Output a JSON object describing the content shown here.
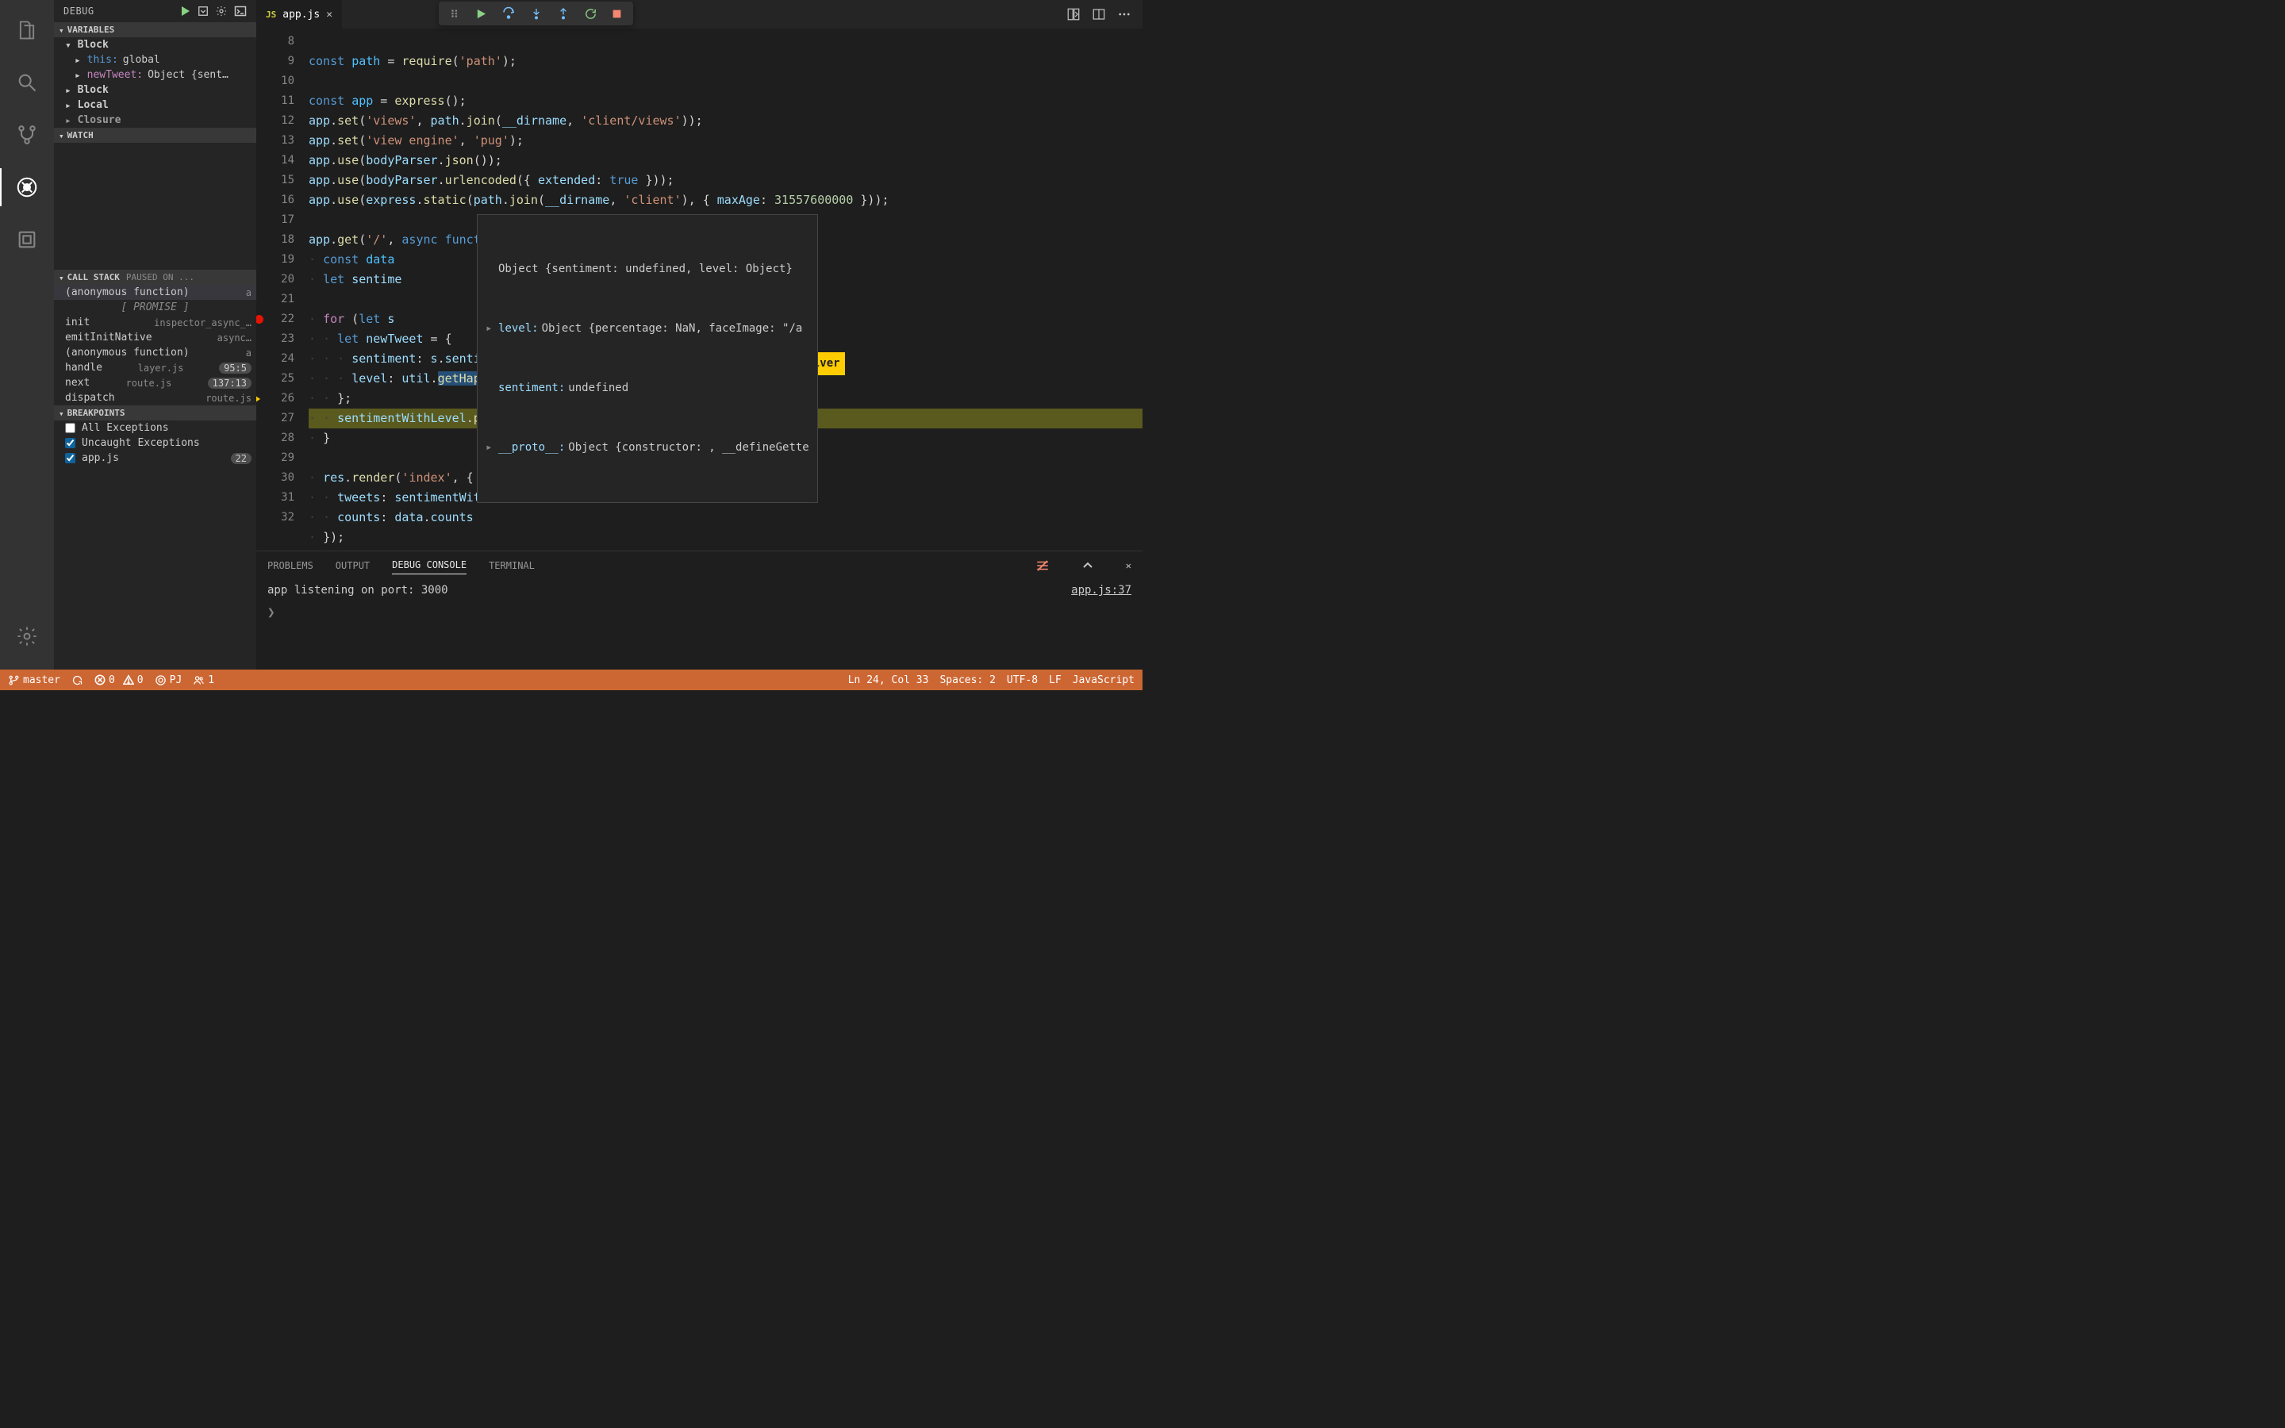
{
  "sidebar": {
    "title": "DEBUG",
    "variables_label": "VARIABLES",
    "watch_label": "WATCH",
    "callstack_label": "CALL STACK",
    "callstack_status": "PAUSED ON ...",
    "breakpoints_label": "BREAKPOINTS",
    "blocks": [
      {
        "label": "Block",
        "expanded": true,
        "items": [
          {
            "name": "this:",
            "value": "global",
            "nameClass": "kw"
          },
          {
            "name": "newTweet:",
            "value": "Object {sent…"
          }
        ]
      },
      {
        "label": "Block",
        "expanded": false
      },
      {
        "label": "Local",
        "expanded": false
      },
      {
        "label": "Closure",
        "expanded": false
      }
    ],
    "callstack": [
      {
        "fn": "(anonymous function)",
        "loc": "a",
        "selected": true
      },
      {
        "promise": "[ PROMISE ]"
      },
      {
        "fn": "init",
        "loc": "inspector_async_…"
      },
      {
        "fn": "emitInitNative",
        "loc": "async…"
      },
      {
        "fn": "(anonymous function)",
        "loc": "a"
      },
      {
        "fn": "handle",
        "loc": "layer.js",
        "badge": "95:5"
      },
      {
        "fn": "next",
        "loc": "route.js",
        "badge": "137:13"
      },
      {
        "fn": "dispatch",
        "loc": "route.js"
      }
    ],
    "breakpoints": [
      {
        "label": "All Exceptions",
        "checked": false
      },
      {
        "label": "Uncaught Exceptions",
        "checked": true
      },
      {
        "label": "app.js",
        "checked": true,
        "badge": "22"
      }
    ]
  },
  "tab": {
    "filename": "app.js",
    "lang_badge": "JS"
  },
  "editor": {
    "first_line": 8,
    "breakpoint_line": 22,
    "current_line": 26
  },
  "hover": {
    "title": "Object {sentiment: undefined, level: Object}",
    "rows": [
      {
        "exp": true,
        "key": "level:",
        "val": "Object {percentage: NaN, faceImage: \"/a"
      },
      {
        "exp": false,
        "key": "sentiment:",
        "val": "undefined"
      },
      {
        "exp": true,
        "key": "__proto__:",
        "val": "Object {constructor: , __defineGette"
      }
    ]
  },
  "liveshare_user": "Amanda Silver",
  "panel": {
    "tabs": [
      "PROBLEMS",
      "OUTPUT",
      "DEBUG CONSOLE",
      "TERMINAL"
    ],
    "active": 2,
    "output": "app listening on port: 3000",
    "link": "app.js:37",
    "prompt": "❯"
  },
  "statusbar": {
    "branch": "master",
    "errors": "0",
    "warnings": "0",
    "liveshare": "PJ",
    "participants": "1",
    "position": "Ln 24, Col 33",
    "spaces": "Spaces: 2",
    "encoding": "UTF-8",
    "eol": "LF",
    "language": "JavaScript"
  }
}
